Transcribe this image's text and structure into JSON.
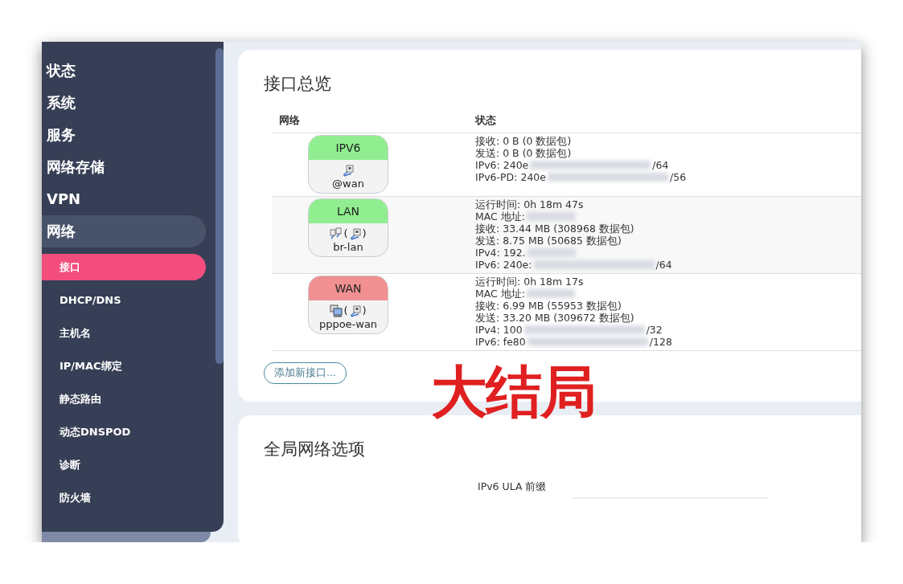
{
  "sidebar": {
    "items": [
      {
        "label": "状态",
        "selected": false
      },
      {
        "label": "系统",
        "selected": false
      },
      {
        "label": "服务",
        "selected": false
      },
      {
        "label": "网络存储",
        "selected": false
      },
      {
        "label": "VPN",
        "selected": false
      },
      {
        "label": "网络",
        "selected": true,
        "children": [
          {
            "label": "接口",
            "selected": true
          },
          {
            "label": "DHCP/DNS",
            "selected": false
          },
          {
            "label": "主机名",
            "selected": false
          },
          {
            "label": "IP/MAC绑定",
            "selected": false
          },
          {
            "label": "静态路由",
            "selected": false
          },
          {
            "label": "动态DNSPOD",
            "selected": false
          },
          {
            "label": "诊断",
            "selected": false
          },
          {
            "label": "防火墙",
            "selected": false
          }
        ]
      }
    ]
  },
  "overview": {
    "title": "接口总览",
    "columns": [
      "网络",
      "状态"
    ],
    "interfaces": [
      {
        "name": "IPV6",
        "color": "#90ee90",
        "icons": [
          {
            "kind": "ethernet"
          }
        ],
        "device": "@wan",
        "lines": [
          {
            "text": "接收: 0 B (0 数据包)",
            "redacted": false
          },
          {
            "text": "发送: 0 B (0 数据包)",
            "redacted": false
          },
          {
            "text": "IPv6: 240e",
            "redacted": true,
            "tail": "/64"
          },
          {
            "text": "IPv6-PD: 240e",
            "redacted": true,
            "tail": "/56"
          }
        ]
      },
      {
        "name": "LAN",
        "color": "#90ee90",
        "icons": [
          {
            "kind": "bridge"
          },
          {
            "kind": "text",
            "text": "("
          },
          {
            "kind": "ethernet"
          },
          {
            "kind": "text",
            "text": ")"
          }
        ],
        "device": "br-lan",
        "lines": [
          {
            "text": "运行时间: 0h 18m 47s",
            "redacted": false
          },
          {
            "text": "MAC 地址:",
            "redacted": true
          },
          {
            "text": "接收: 33.44 MB (308968 数据包)",
            "redacted": false
          },
          {
            "text": "发送: 8.75 MB (50685 数据包)",
            "redacted": false
          },
          {
            "text": "IPv4: 192.",
            "redacted": true
          },
          {
            "text": "IPv6: 240e:",
            "redacted": true,
            "tail": "/64"
          }
        ]
      },
      {
        "name": "WAN",
        "color": "#f09090",
        "icons": [
          {
            "kind": "pppoe"
          },
          {
            "kind": "text",
            "text": "("
          },
          {
            "kind": "ethernet"
          },
          {
            "kind": "text",
            "text": ")"
          }
        ],
        "device": "pppoe-wan",
        "lines": [
          {
            "text": "运行时间: 0h 18m 17s",
            "redacted": false
          },
          {
            "text": "MAC 地址:",
            "redacted": true
          },
          {
            "text": "接收: 6.99 MB (55953 数据包)",
            "redacted": false
          },
          {
            "text": "发送: 33.20 MB (309672 数据包)",
            "redacted": false
          },
          {
            "text": "IPv4: 100",
            "redacted": true,
            "tail": "/32"
          },
          {
            "text": "IPv6: fe80",
            "redacted": true,
            "tail": "/128"
          }
        ]
      }
    ],
    "add_button": "添加新接口..."
  },
  "annotation": "大结局",
  "global": {
    "title": "全局网络选项",
    "fields": [
      {
        "label": "IPv6 ULA 前缀"
      }
    ]
  }
}
